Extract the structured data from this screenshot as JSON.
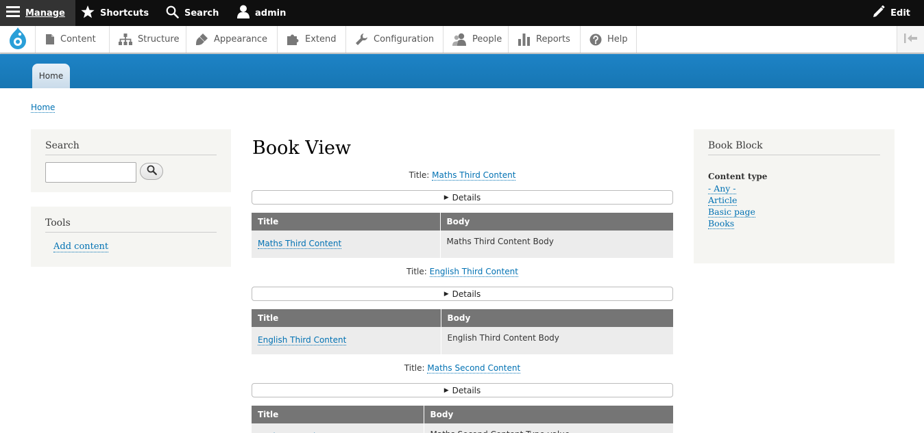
{
  "toolbar": {
    "manage": "Manage",
    "shortcuts": "Shortcuts",
    "search": "Search",
    "user": "admin",
    "edit": "Edit"
  },
  "tray": {
    "items": [
      "Content",
      "Structure",
      "Appearance",
      "Extend",
      "Configuration",
      "People",
      "Reports",
      "Help"
    ]
  },
  "header": {
    "home_tab": "Home"
  },
  "breadcrumb": {
    "home": "Home"
  },
  "search_block": {
    "title": "Search"
  },
  "tools_block": {
    "title": "Tools",
    "add_content": "Add content"
  },
  "book_block": {
    "title": "Book Block",
    "content_type_label": "Content type",
    "options": [
      "- Any -",
      "Article",
      "Basic page",
      "Books"
    ]
  },
  "main": {
    "page_title": "Book View",
    "title_prefix": "Title:",
    "details_label": "Details",
    "col_title": "Title",
    "col_body": "Body",
    "rows": [
      {
        "title": "Maths Third Content",
        "body": "Maths Third Content Body"
      },
      {
        "title": "English Third Content",
        "body": "English Third Content Body"
      },
      {
        "title": "Maths Second Content",
        "body": "Maths Second Content Type value"
      }
    ]
  },
  "colors": {
    "toolbar_bg": "#0f0f0f",
    "header_blue": "#1b80c1",
    "link": "#0071b3",
    "table_header": "#757575",
    "sidebar_bg": "#f5f5f2"
  }
}
